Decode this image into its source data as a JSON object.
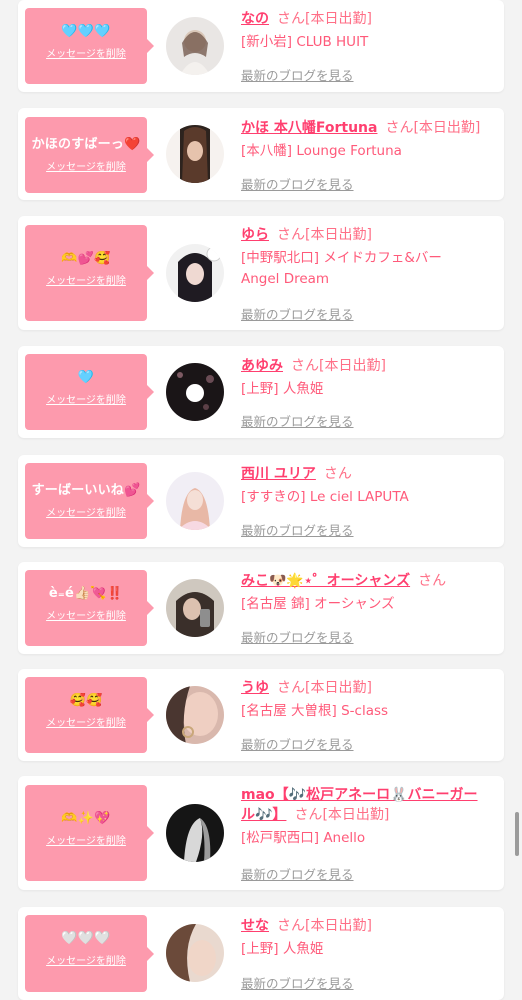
{
  "common": {
    "delete_label": "メッセージを削除",
    "blog_label": "最新のブログを見る",
    "san": "さん"
  },
  "colors": {
    "accent": "#ff3f6f",
    "message_box": "#fd9aad",
    "muted": "#9a9a9a"
  },
  "cards": [
    {
      "message": "🩵🩵🩵",
      "name": "なの",
      "status": "[本日出勤]",
      "shop": "[新小岩] CLUB HUIT",
      "shop2": ""
    },
    {
      "message": "かほのすばーっ❤️",
      "name": "かほ 本八幡Fortuna",
      "status": "[本日出勤]",
      "shop": "[本八幡] Lounge Fortuna",
      "shop2": ""
    },
    {
      "message": "🫶💕🥰",
      "name": "ゆら",
      "status": "[本日出勤]",
      "shop": "[中野駅北口] メイドカフェ&バー",
      "shop2": "Angel Dream"
    },
    {
      "message": "🩵",
      "name": "あゆみ",
      "status": "[本日出勤]",
      "shop": "[上野] 人魚姫",
      "shop2": ""
    },
    {
      "message": "すーばーいいね💕",
      "name": "西川 ユリア",
      "status": "",
      "shop": "[すすきの] Le ciel LAPUTA",
      "shop2": ""
    },
    {
      "message": "è₌é👍🏻💘‼️",
      "name": "みこ🐶🌟⋆゜オーシャンズ",
      "status": "",
      "shop": "[名古屋 錦] オーシャンズ",
      "shop2": ""
    },
    {
      "message": "🥰🥰",
      "name": "うゆ",
      "status": "[本日出勤]",
      "shop": "[名古屋 大曽根] S-class",
      "shop2": ""
    },
    {
      "message": "🫶✨💖",
      "name": "mao【🎶松戸アネーロ🐰バニーガール🎶】",
      "status": "[本日出勤]",
      "shop": "[松戸駅西口] Anello",
      "shop2": ""
    },
    {
      "message": "🤍🤍🤍",
      "name": "せな",
      "status": "[本日出勤]",
      "shop": "[上野] 人魚姫",
      "shop2": ""
    }
  ]
}
